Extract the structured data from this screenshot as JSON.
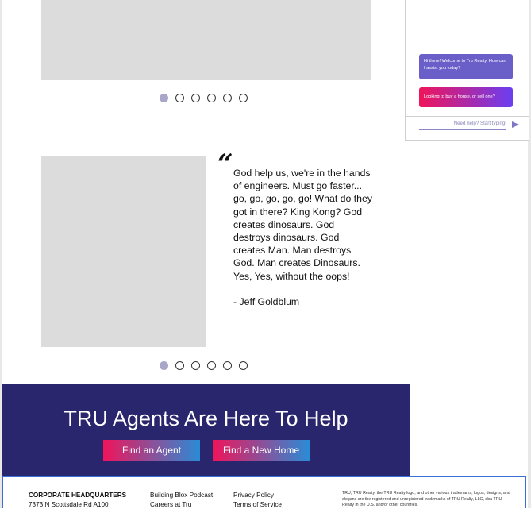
{
  "quote": {
    "mark": "“",
    "text": "God help us, we're in the hands of engineers. Must go faster... go, go, go, go, go! What do they got in there? King Kong? God creates dinosaurs. God destroys dinosaurs. God creates Man. Man destroys God. Man creates Dinosaurs. Yes, Yes, without the oops!",
    "author": "- Jeff Goldblum"
  },
  "carousel": {
    "dot_count": 6,
    "active_index": 0
  },
  "chat": {
    "bot_message": "Hi there! Welcome to Tru Realty. How can I assist you today?",
    "user_option": "Looking to buy a house, or sell one?",
    "input_placeholder": "Need help? Start typing!"
  },
  "cta": {
    "title": "TRU Agents Are Here To Help",
    "find_agent_label": "Find an Agent",
    "find_home_label": "Find a New Home"
  },
  "footer": {
    "hq_title": "CORPORATE HEADQUARTERS",
    "hq_address": "7373 N Scottsdale Rd A100",
    "podcast_link": "Building Blox Podcast",
    "careers_link": "Careers at Tru",
    "privacy_link": "Privacy Policy",
    "terms_link": "Terms of Service",
    "legal": "TRU, TRU Realty, the TRU Realty logo, and other various trademarks, logos, designs, and slogans are the registered and unregistered trademarks of TRU Realty, LLC, dba TRU Realty in the U.S. and/or other countries."
  },
  "colors": {
    "cta_background": "#2a266e",
    "active_dot": "#a9a6c9",
    "chat_bot_bubble": "#6a5fc8"
  }
}
